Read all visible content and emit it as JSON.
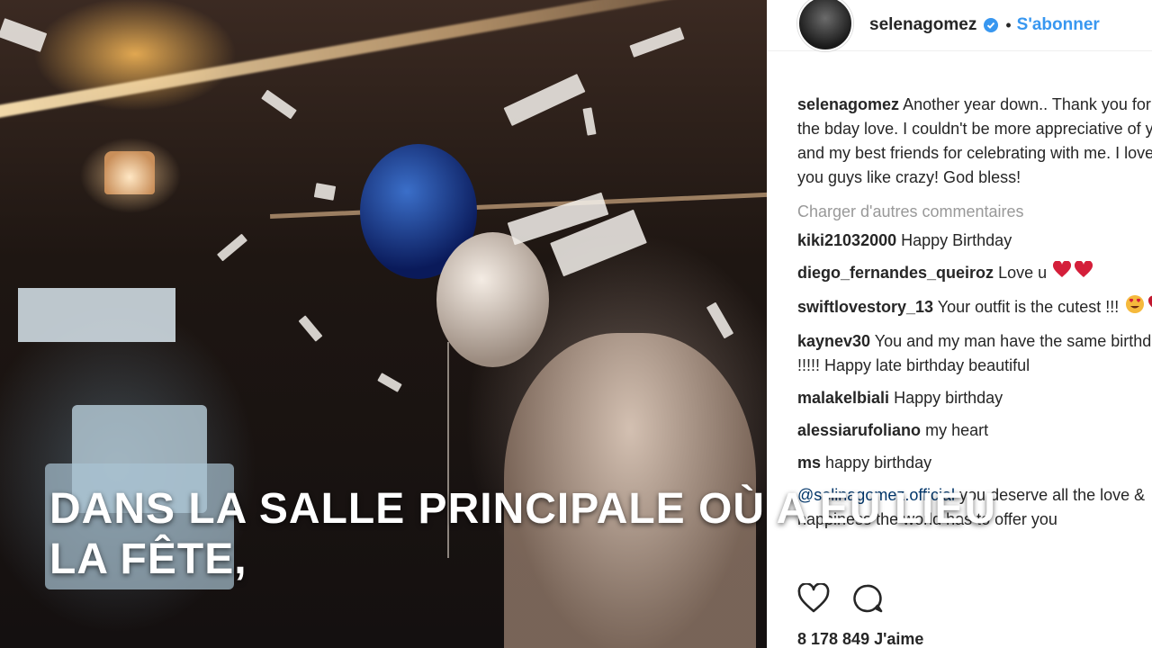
{
  "overlay": {
    "text": "DANS LA SALLE PRINCIPALE OÙ A EU LIEU LA FÊTE,"
  },
  "post": {
    "username": "selenagomez",
    "follow_label": "S'abonner",
    "separator": "•",
    "caption_user": "selenagomez",
    "caption_text": "Another year down.. Thank you for all the bday love. I couldn't be more appreciative of you and my best friends for celebrating with me. I love you guys like crazy! God bless!",
    "load_more": "Charger d'autres commentaires",
    "comments": [
      {
        "user": "kiki21032000",
        "text": "Happy Birthday"
      },
      {
        "user": "diego_fernandes_queiroz",
        "text": "Love u"
      },
      {
        "user": "swiftlovestory_13",
        "text": "Your outfit is the cutest !!!"
      },
      {
        "user": "kaynev30",
        "text": "You and my man have the same birthday !!!!! Happy late birthday beautiful"
      },
      {
        "user": "malakelbiali",
        "text": "Happy birthday"
      },
      {
        "user": "alessiarufoliano",
        "text": "my heart"
      },
      {
        "user": "ms",
        "text": "happy birthday"
      },
      {
        "user": "",
        "mention": "@selinagomez.official",
        "text": "you deserve all the love & happiness the world has to offer you"
      }
    ],
    "likes": "8 178 849 J'aime"
  },
  "icons": {
    "verified": "verified-badge-icon",
    "like": "heart-outline-icon",
    "comment": "comment-bubble-icon",
    "heart_emoji": "red-heart-emoji",
    "heart_eyes_emoji": "heart-eyes-emoji"
  },
  "colors": {
    "link": "#3897f0",
    "heart": "#ed4956",
    "text": "#262626",
    "muted": "#999999"
  }
}
